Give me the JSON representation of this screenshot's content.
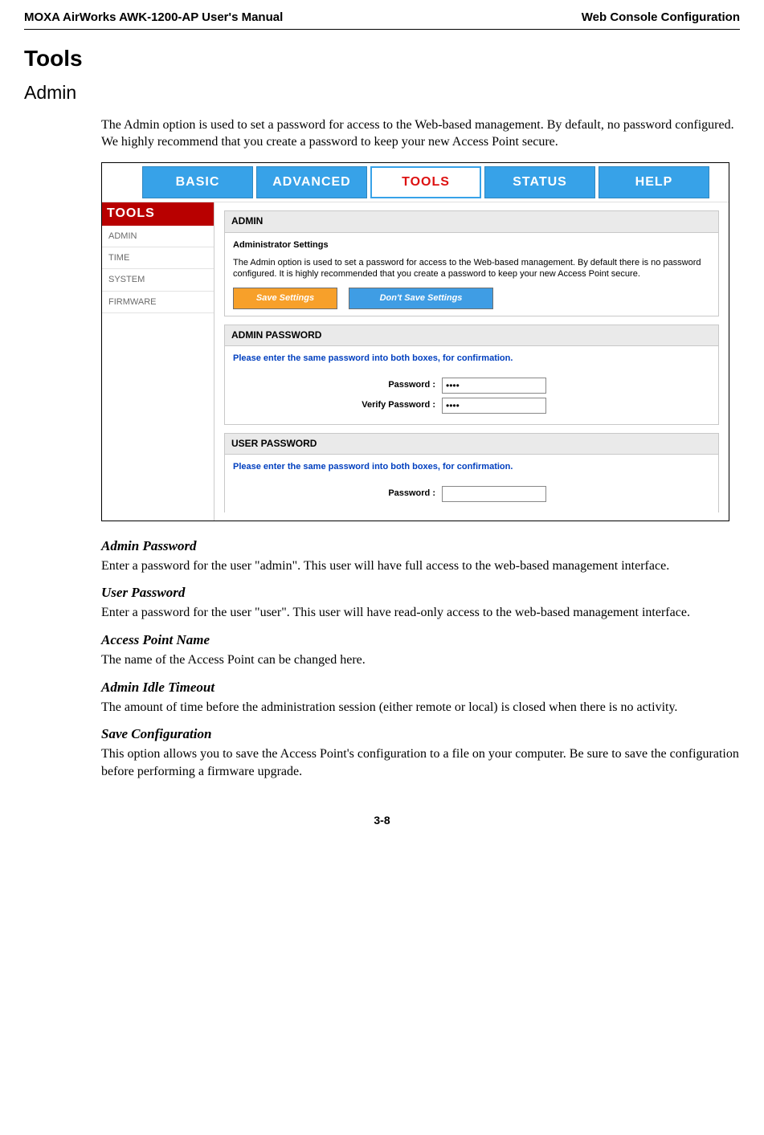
{
  "header": {
    "left": "MOXA AirWorks AWK-1200-AP User's Manual",
    "right": "Web Console Configuration"
  },
  "h1": "Tools",
  "h2": "Admin",
  "intro": "The Admin option is used to set a password for access to the Web-based management. By default, no password configured. We highly recommend that you create a password to keep your new Access Point secure.",
  "nav": {
    "basic": "BASIC",
    "advanced": "ADVANCED",
    "tools": "TOOLS",
    "status": "STATUS",
    "help": "HELP"
  },
  "sidebar": {
    "title": "TOOLS",
    "items": [
      "ADMIN",
      "TIME",
      "SYSTEM",
      "FIRMWARE"
    ]
  },
  "panels": {
    "admin": {
      "title": "ADMIN",
      "sub": "Administrator Settings",
      "desc": "The Admin option is used to set a password for access to the Web-based management. By default there is no password configured. It is highly recommended that you create a password to keep your new Access Point secure.",
      "save_btn": "Save Settings",
      "dont_btn": "Don't Save Settings"
    },
    "adminpw": {
      "title": "ADMIN PASSWORD",
      "hint": "Please enter the same password into both boxes, for confirmation.",
      "pw_label": "Password :",
      "vpw_label": "Verify Password :",
      "pw_value": "••••",
      "vpw_value": "••••"
    },
    "userpw": {
      "title": "USER PASSWORD",
      "hint": "Please enter the same password into both boxes, for confirmation.",
      "pw_label": "Password :",
      "pw_value": ""
    }
  },
  "sections": {
    "adminpw_h": "Admin Password",
    "adminpw_t": "Enter a password for the user \"admin\". This user will have full access to the web-based management interface.",
    "userpw_h": "User Password",
    "userpw_t": "Enter a password for the user \"user\". This user will have read-only access to the web-based management interface.",
    "apname_h": "Access Point Name",
    "apname_t": "The name of the Access Point can be changed here.",
    "idle_h": "Admin Idle Timeout",
    "idle_t": "The amount of time before the administration session (either remote or local) is closed when there is no activity.",
    "savecfg_h": "Save Configuration",
    "savecfg_t": "This option allows you to save the Access Point's configuration to a file on your computer. Be sure to save the configuration before performing a firmware upgrade."
  },
  "page_num": "3-8"
}
